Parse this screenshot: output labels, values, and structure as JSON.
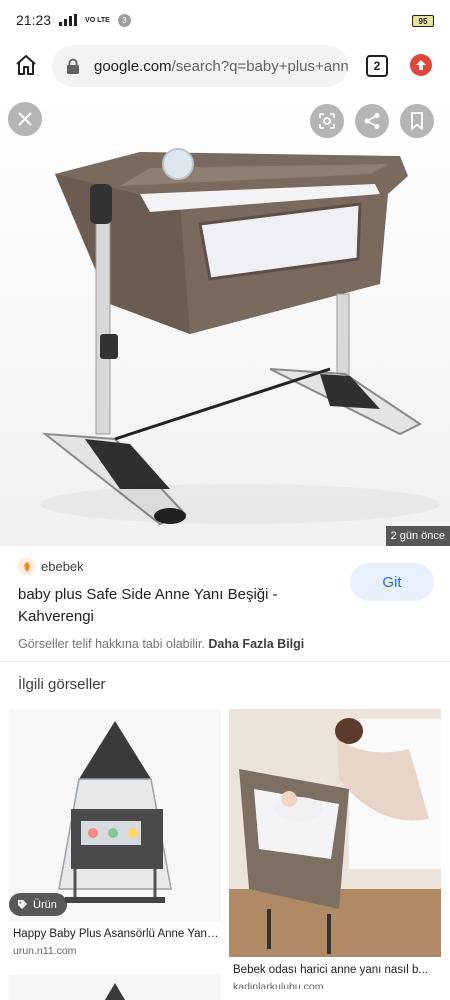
{
  "status_bar": {
    "time": "21:23",
    "network": "4G",
    "volte": "VO LTE",
    "notification_count": "3",
    "battery": "95"
  },
  "browser": {
    "url_domain": "google.com",
    "url_path": "/search?q=baby+plus+anne",
    "tab_count": "2",
    "icons": [
      "home-icon",
      "lock-icon",
      "tabs-icon",
      "update-icon"
    ]
  },
  "viewer": {
    "icons": [
      "close-icon",
      "lens-icon",
      "share-icon",
      "bookmark-icon"
    ],
    "age_badge": "2 gün önce",
    "source_name": "ebebek",
    "title": "baby plus Safe Side Anne Yanı Beşiği - Kahverengi",
    "go_button": "Git",
    "copyright_text": "Görseller telif hakkına tabi olabilir.",
    "more_info": "Daha Fazla Bilgi"
  },
  "related": {
    "heading": "İlgili görseller",
    "items": [
      {
        "title": "Happy Baby Plus Asansörlü Anne Yanı...",
        "domain": "urun.n11.com",
        "badge": "Ürün"
      },
      {
        "title": "Bebek odası harici anne yanı nasıl b...",
        "domain": "kadinlarkulubu.com",
        "badge": ""
      }
    ]
  },
  "colors": {
    "accent_blue": "#1a73e8",
    "button_bg": "#e8f0fe",
    "update_red": "#e0463a",
    "crib_brown": "#7a6a5e"
  }
}
